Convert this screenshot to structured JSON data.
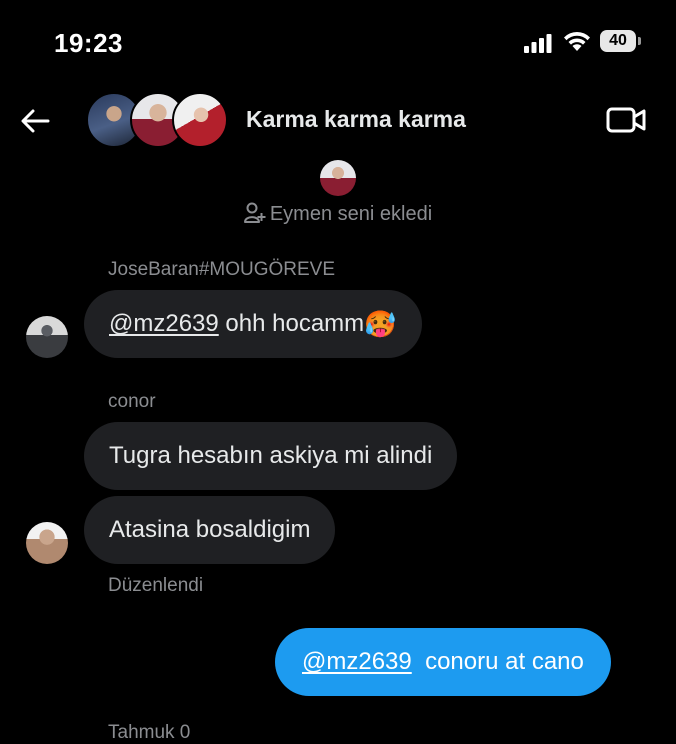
{
  "status_bar": {
    "time": "19:23",
    "battery": "40"
  },
  "header": {
    "title": "Karma karma karma"
  },
  "system_note": {
    "text": "Eymen seni ekledi"
  },
  "messages": [
    {
      "sender": "JoseBaran#MOUGÖREVE",
      "mention": "@mz2639",
      "text": " ohh hocamm",
      "emoji": "🥵"
    },
    {
      "sender": "conor",
      "text": "Tugra hesabın askiya mi alindi"
    },
    {
      "text": "Atasina bosaldigim",
      "edited_label": "Düzenlendi"
    }
  ],
  "outgoing": {
    "mention": "@mz2639",
    "text": "  conoru at cano"
  },
  "next_sender_partial": "Tahmuk 0"
}
